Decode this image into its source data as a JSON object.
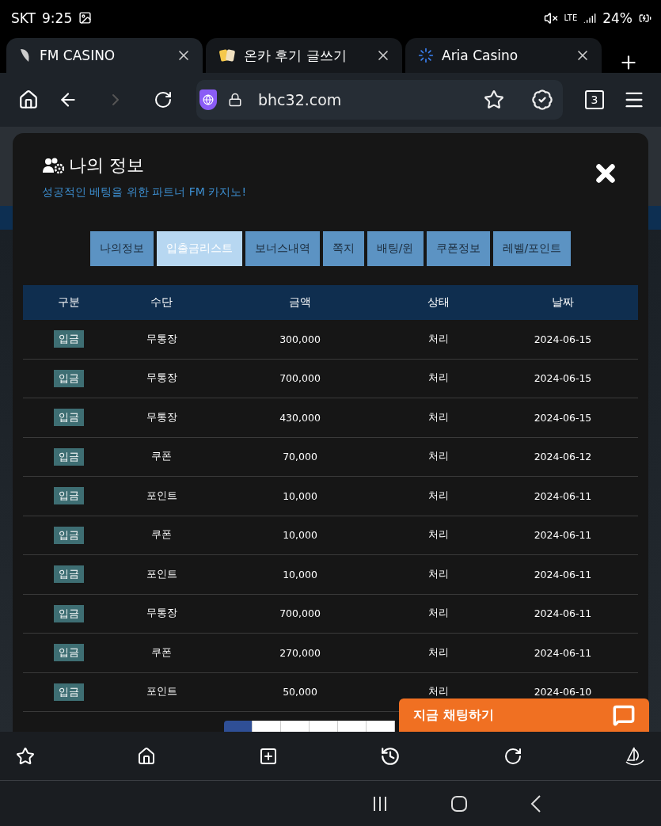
{
  "status_bar": {
    "carrier": "SKT",
    "time": "9:25",
    "network": "LTE",
    "battery": "24%"
  },
  "browser_tabs": [
    {
      "title": "FM CASINO",
      "selected": true
    },
    {
      "title": "온카 후기 글쓰기",
      "selected": false
    },
    {
      "title": "Aria Casino",
      "selected": false
    }
  ],
  "address_bar": {
    "url": "bhc32.com",
    "tab_count": "3"
  },
  "modal": {
    "title": "나의 정보",
    "subtitle": "성공적인 베팅을 위한 파트너 FM 카지노!",
    "tabs": [
      {
        "label": "나의정보",
        "selected": false
      },
      {
        "label": "입출금리스트",
        "selected": true
      },
      {
        "label": "보너스내역",
        "selected": false
      },
      {
        "label": "쪽지",
        "selected": false
      },
      {
        "label": "배팅/윈",
        "selected": false
      },
      {
        "label": "쿠폰정보",
        "selected": false
      },
      {
        "label": "레벨/포인트",
        "selected": false
      }
    ],
    "table": {
      "columns": [
        "구분",
        "수단",
        "금액",
        "상태",
        "날짜"
      ],
      "rows": [
        [
          "입금",
          "무통장",
          "300,000",
          "처리",
          "2024-06-15"
        ],
        [
          "입금",
          "무통장",
          "700,000",
          "처리",
          "2024-06-15"
        ],
        [
          "입금",
          "무통장",
          "430,000",
          "처리",
          "2024-06-15"
        ],
        [
          "입금",
          "쿠폰",
          "70,000",
          "처리",
          "2024-06-12"
        ],
        [
          "입금",
          "포인트",
          "10,000",
          "처리",
          "2024-06-11"
        ],
        [
          "입금",
          "쿠폰",
          "10,000",
          "처리",
          "2024-06-11"
        ],
        [
          "입금",
          "포인트",
          "10,000",
          "처리",
          "2024-06-11"
        ],
        [
          "입금",
          "무통장",
          "700,000",
          "처리",
          "2024-06-11"
        ],
        [
          "입금",
          "쿠폰",
          "270,000",
          "처리",
          "2024-06-11"
        ],
        [
          "입금",
          "포인트",
          "50,000",
          "처리",
          "2024-06-10"
        ]
      ]
    }
  },
  "chat_button": {
    "label": "지금 채팅하기"
  }
}
